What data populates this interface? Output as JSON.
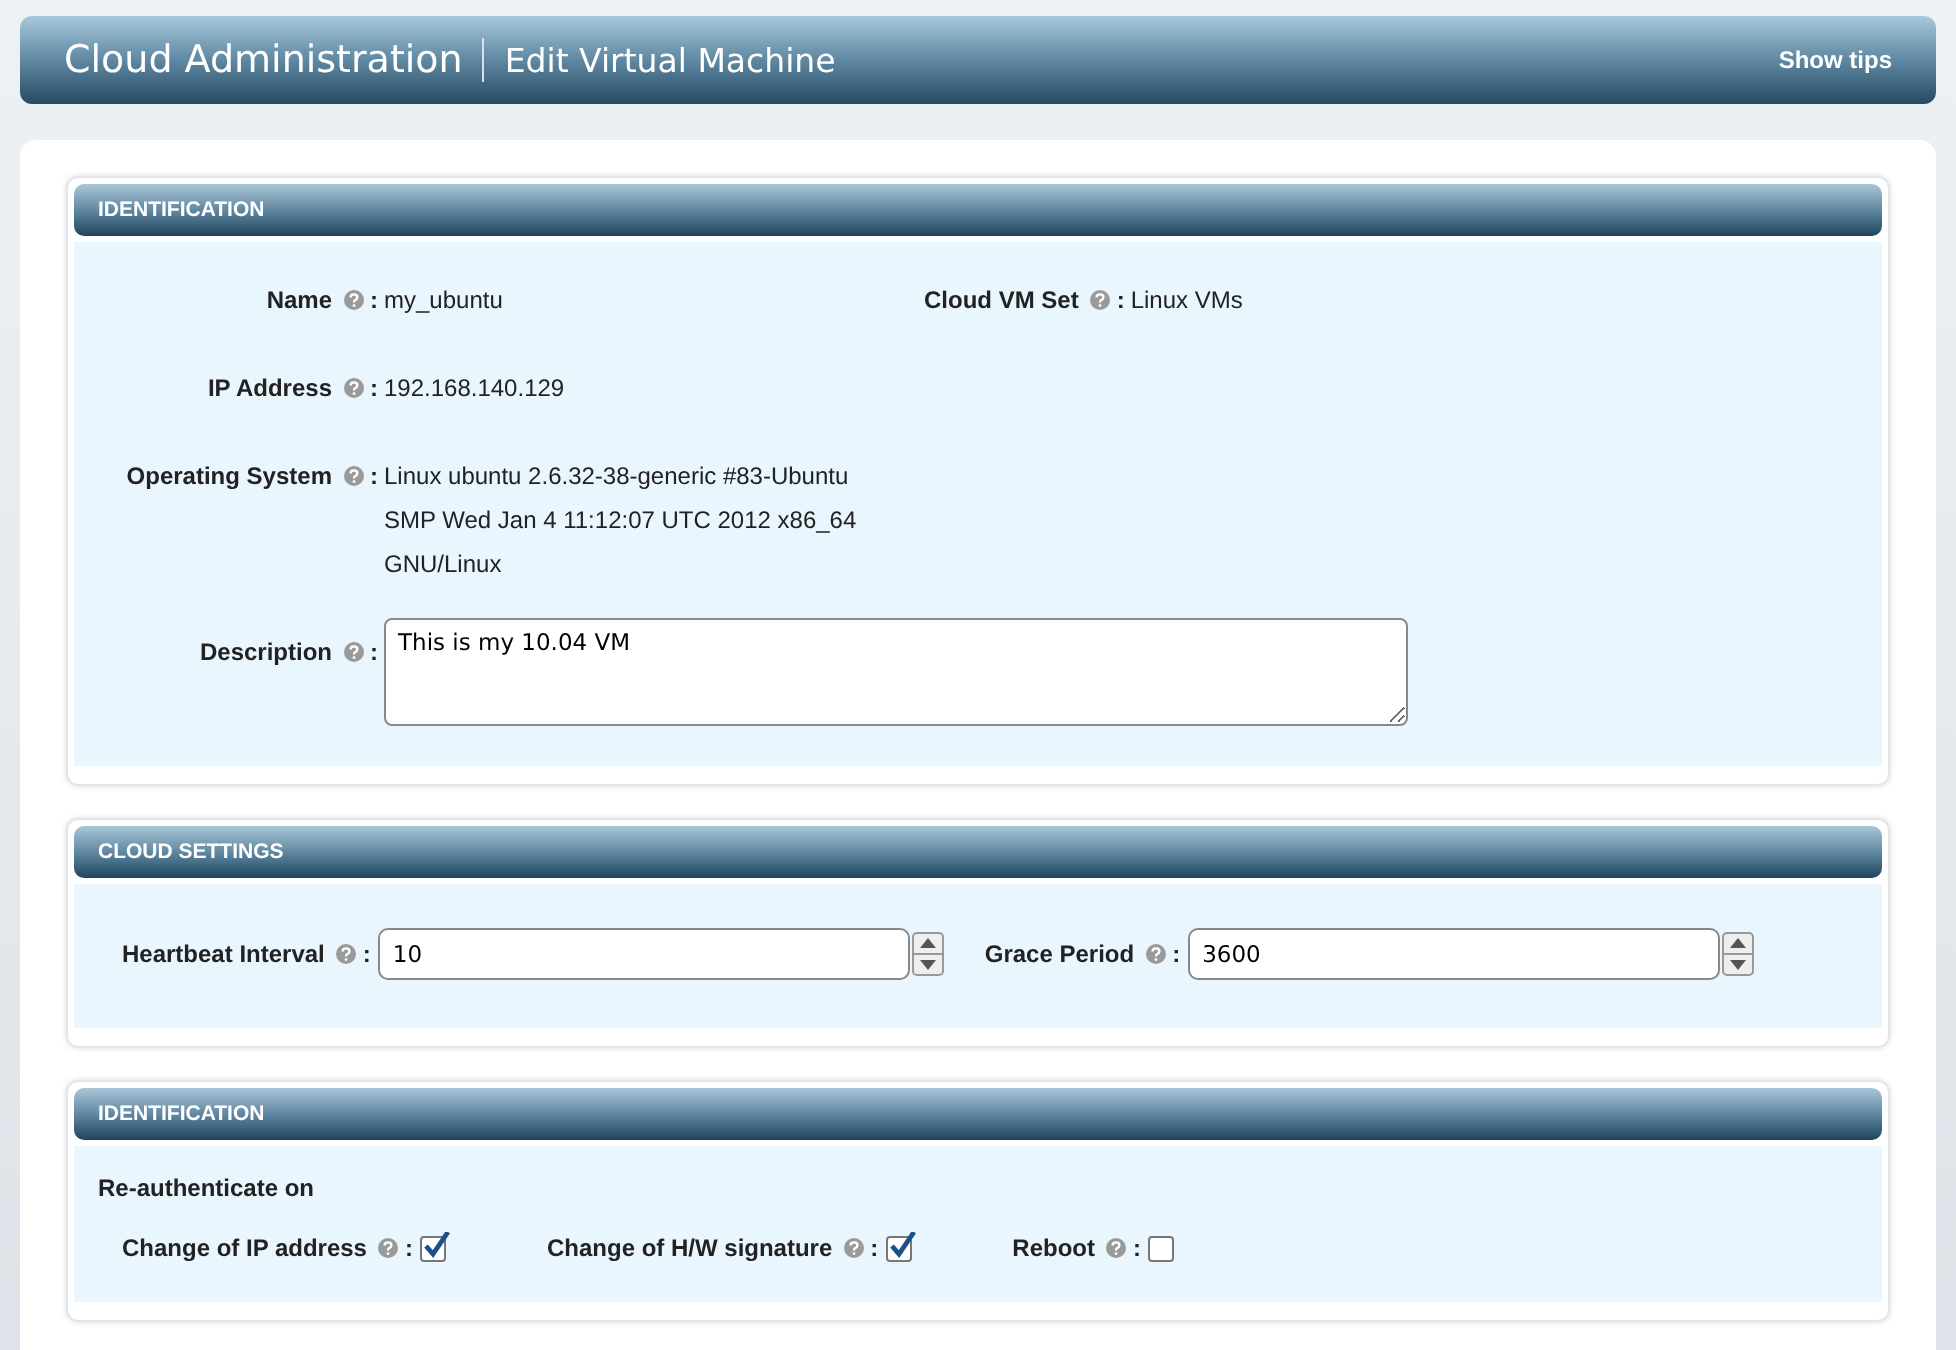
{
  "header": {
    "app_title": "Cloud Administration",
    "page_title": "Edit Virtual Machine",
    "tips_link": "Show tips"
  },
  "identification": {
    "title": "IDENTIFICATION",
    "name": {
      "label": "Name",
      "separator": ":",
      "value": "my_ubuntu"
    },
    "vm_set": {
      "label": "Cloud VM Set",
      "separator": ":",
      "value": "Linux VMs"
    },
    "ip": {
      "label": "IP Address",
      "separator": ":",
      "value": "192.168.140.129"
    },
    "os": {
      "label": "Operating System",
      "separator": ":",
      "lines": [
        "Linux ubuntu 2.6.32-38-generic #83-Ubuntu",
        "SMP Wed Jan 4 11:12:07 UTC 2012 x86_64",
        "GNU/Linux"
      ]
    },
    "description": {
      "label": "Description",
      "separator": ":",
      "value": "This is my 10.04 VM"
    }
  },
  "cloud_settings": {
    "title": "CLOUD SETTINGS",
    "fields": [
      {
        "label": "Heartbeat Interval",
        "separator": ":",
        "value": "10"
      },
      {
        "label": "Grace Period",
        "separator": ":",
        "value": "3600"
      }
    ]
  },
  "reauth": {
    "title": "IDENTIFICATION",
    "subtitle": "Re-authenticate on",
    "options": [
      {
        "label": "Change of IP address",
        "separator": ":",
        "checked": true
      },
      {
        "label": "Change of H/W signature",
        "separator": ":",
        "checked": true
      },
      {
        "label": "Reboot",
        "separator": ":",
        "checked": false
      }
    ]
  }
}
